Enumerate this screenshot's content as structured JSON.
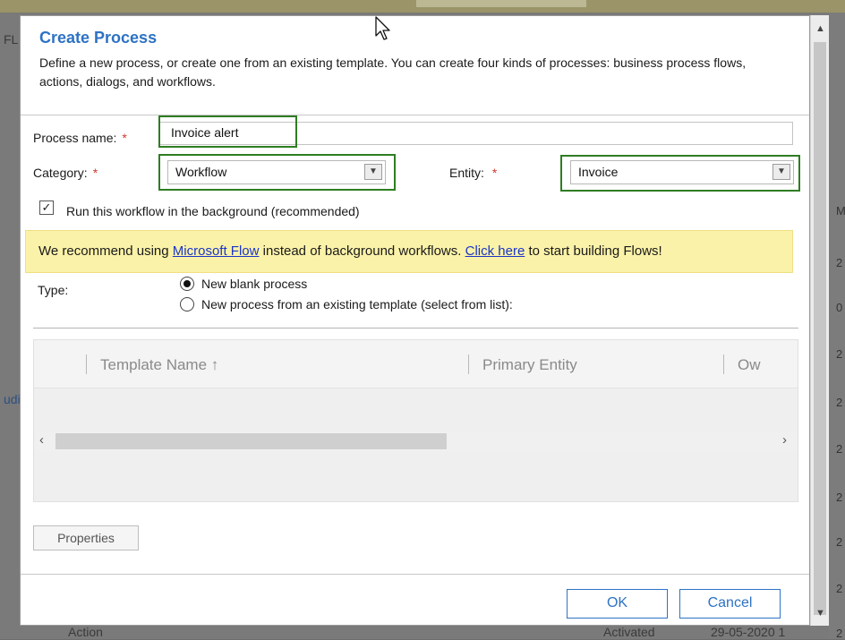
{
  "background": {
    "left_text": [
      "FL",
      "udi"
    ],
    "right_text": [
      "M",
      "2",
      "0",
      "2",
      "2",
      "2",
      "2",
      "2",
      "2",
      "2",
      "2"
    ],
    "bottom_row": [
      "Action",
      "Activated",
      "29-05-2020 1"
    ]
  },
  "dialog": {
    "title": "Create Process",
    "description": "Define a new process, or create one from an existing template. You can create four kinds of processes: business process flows, actions, dialogs, and workflows."
  },
  "form": {
    "process_name_label": "Process name:",
    "process_name_value": "Invoice alert",
    "category_label": "Category:",
    "category_value": "Workflow",
    "entity_label": "Entity:",
    "entity_value": "Invoice",
    "required_marker": "*",
    "run_background_label": "Run this workflow in the background (recommended)",
    "run_background_checked": true
  },
  "banner": {
    "text_before": "We recommend using ",
    "link1": "Microsoft Flow",
    "text_middle": " instead of background workflows. ",
    "link2": "Click here",
    "text_after": " to start building Flows!"
  },
  "type": {
    "label": "Type:",
    "options": [
      "New blank process",
      "New process from an existing template (select from list):"
    ],
    "selected_index": 0
  },
  "template_grid": {
    "columns": [
      "Template Name ↑",
      "Primary Entity",
      "Ow"
    ]
  },
  "buttons": {
    "properties": "Properties",
    "ok": "OK",
    "cancel": "Cancel"
  },
  "colors": {
    "title_blue": "#2d72c4",
    "highlight_green": "#2e7d22",
    "required_red": "#d23a2f",
    "banner_yellow": "#fbf2a9",
    "link_blue": "#1a35c8"
  }
}
